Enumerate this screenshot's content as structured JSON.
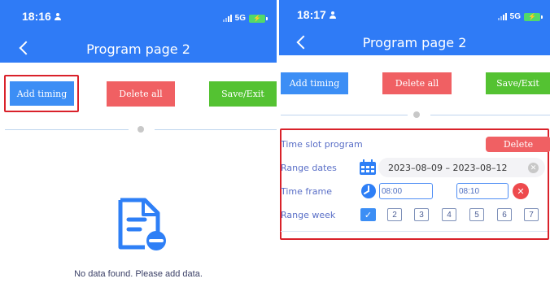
{
  "left_screen": {
    "status_time": "18:16",
    "network": "5G",
    "title": "Program page 2",
    "buttons": {
      "add_timing": "Add timing",
      "delete_all": "Delete all",
      "save_exit": "Save/Exit"
    },
    "empty_message": "No data found. Please add data."
  },
  "right_screen": {
    "status_time": "18:17",
    "network": "5G",
    "title": "Program page 2",
    "buttons": {
      "add_timing": "Add timing",
      "delete_all": "Delete all",
      "save_exit": "Save/Exit"
    },
    "time_slot": {
      "label": "Time slot program",
      "delete_label": "Delete",
      "range_dates_label": "Range dates",
      "date_range": "2023–08–09 –  2023–08–12",
      "time_frame_label": "Time frame",
      "start_time": "08:00",
      "end_time": "08:10",
      "range_week_label": "Range week",
      "week_days": [
        "2",
        "3",
        "4",
        "5",
        "6",
        "7"
      ],
      "week_first_checked": true
    }
  },
  "icons": {
    "back": "chevron-left-icon",
    "empty_state": "document-remove-icon",
    "calendar": "calendar-icon",
    "clock": "clock-icon",
    "clear": "close-icon",
    "check": "checkmark-icon"
  },
  "colors": {
    "header_blue": "#2f7bf6",
    "button_blue": "#3c8ef5",
    "button_red": "#f06063",
    "button_green": "#54c232",
    "highlight_red": "#d9212a"
  }
}
